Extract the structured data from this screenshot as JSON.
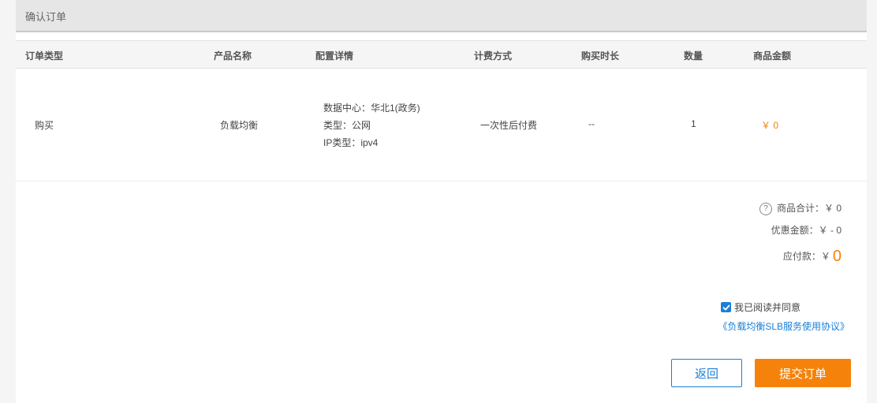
{
  "panel": {
    "title": "确认订单"
  },
  "table": {
    "headers": [
      "订单类型",
      "产品名称",
      "配置详情",
      "计费方式",
      "购买时长",
      "数量",
      "商品金额"
    ],
    "row": {
      "order_type": "购买",
      "product_name": "负载均衡",
      "config": [
        "数据中心：华北1(政务)",
        "类型：公网",
        "IP类型：ipv4"
      ],
      "billing": "一次性后付费",
      "duration": "--",
      "quantity": "1",
      "amount": "￥ 0"
    }
  },
  "summary": {
    "help_icon": "question-circle-icon",
    "goods_total": "商品合计：￥ 0",
    "discount": "优惠金额：￥ - 0",
    "payable_label": "应付款：￥",
    "payable_value": "0"
  },
  "agreement": {
    "checked": true,
    "label": "我已阅读并同意",
    "link": "《负载均衡SLB服务使用协议》"
  },
  "actions": {
    "back": "返回",
    "submit": "提交订单"
  },
  "colors": {
    "accent": "#1a7fd6",
    "price": "#f5820a"
  }
}
